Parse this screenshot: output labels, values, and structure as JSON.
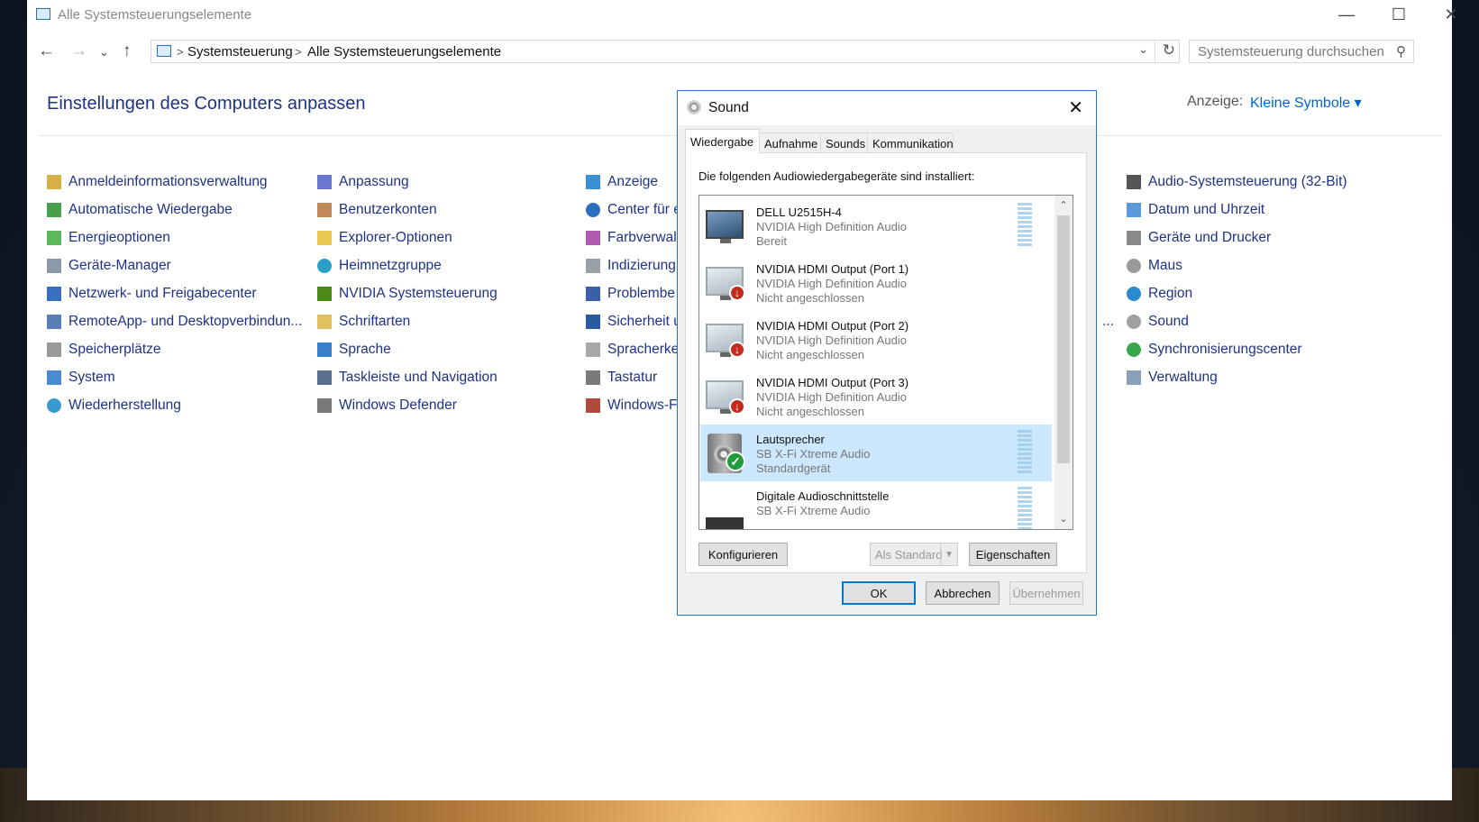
{
  "window": {
    "title": "Alle Systemsteuerungselemente"
  },
  "address": {
    "crumbs": [
      "Systemsteuerung",
      "Alle Systemsteuerungselemente"
    ],
    "search_placeholder": "Systemsteuerung durchsuchen"
  },
  "heading": "Einstellungen des Computers anpassen",
  "view": {
    "label": "Anzeige:",
    "value": "Kleine Symbole ▾"
  },
  "items": {
    "col1": [
      "Anmeldeinformationsverwaltung",
      "Automatische Wiedergabe",
      "Energieoptionen",
      "Geräte-Manager",
      "Netzwerk- und Freigabecenter",
      "RemoteApp- und Desktopverbindun...",
      "Speicherplätze",
      "System",
      "Wiederherstellung"
    ],
    "col2": [
      "Anpassung",
      "Benutzerkonten",
      "Explorer-Optionen",
      "Heimnetzgruppe",
      "NVIDIA Systemsteuerung",
      "Schriftarten",
      "Sprache",
      "Taskleiste und Navigation",
      "Windows Defender"
    ],
    "col3": [
      "Anzeige",
      "Center für e",
      "Farbverwalt",
      "Indizierung",
      "Problembe",
      "Sicherheit u",
      "Spracherke",
      "Tastatur",
      "Windows-F"
    ],
    "col4_fragment": "...",
    "col5": [
      "Audio-Systemsteuerung (32-Bit)",
      "Datum und Uhrzeit",
      "Geräte und Drucker",
      "Maus",
      "Region",
      "Sound",
      "Synchronisierungscenter",
      "Verwaltung"
    ]
  },
  "dialog": {
    "title": "Sound",
    "tabs": [
      "Wiedergabe",
      "Aufnahme",
      "Sounds",
      "Kommunikation"
    ],
    "intro": "Die folgenden Audiowiedergabegeräte sind installiert:",
    "devices": [
      {
        "name": "DELL U2515H-4",
        "driver": "NVIDIA High Definition Audio",
        "status": "Bereit",
        "icon": "monitor-icon"
      },
      {
        "name": "NVIDIA HDMI Output (Port 1)",
        "driver": "NVIDIA High Definition Audio",
        "status": "Nicht angeschlossen",
        "icon": "monitor-disconnected-icon"
      },
      {
        "name": "NVIDIA HDMI Output (Port 2)",
        "driver": "NVIDIA High Definition Audio",
        "status": "Nicht angeschlossen",
        "icon": "monitor-disconnected-icon"
      },
      {
        "name": "NVIDIA HDMI Output (Port 3)",
        "driver": "NVIDIA High Definition Audio",
        "status": "Nicht angeschlossen",
        "icon": "monitor-disconnected-icon"
      },
      {
        "name": "Lautsprecher",
        "driver": "SB X-Fi Xtreme Audio",
        "status": "Standardgerät",
        "icon": "speaker-default-icon"
      },
      {
        "name": "Digitale Audioschnittstelle",
        "driver": "SB X-Fi Xtreme Audio",
        "status": "",
        "icon": "digital-audio-icon"
      }
    ],
    "buttons": {
      "configure": "Konfigurieren",
      "set_default": "Als Standard",
      "properties": "Eigenschaften",
      "ok": "OK",
      "cancel": "Abbrechen",
      "apply": "Übernehmen"
    }
  }
}
